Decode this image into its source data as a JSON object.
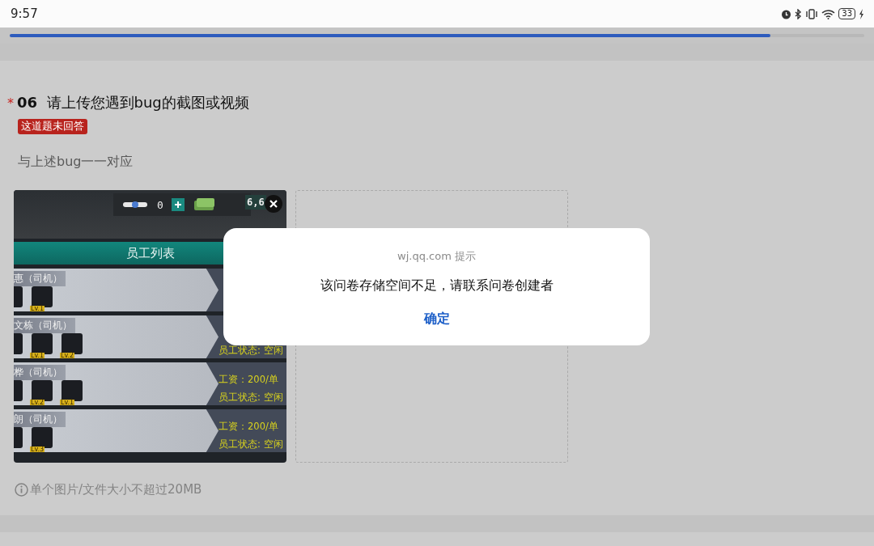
{
  "status_bar": {
    "time": "9:57",
    "battery": "33"
  },
  "progress": {
    "level": 0.89
  },
  "question": {
    "required_mark": "*",
    "number": "06",
    "title": "请上传您遇到bug的截图或视频",
    "error_badge": "这道题未回答",
    "description": "与上述bug一一对应"
  },
  "uploads": [
    {
      "kind": "screenshot",
      "currency": "0",
      "money": "6,6",
      "header": "员工列表",
      "rows": [
        {
          "name": "惠（司机）",
          "skills": [
            "Lv.1"
          ]
        },
        {
          "name": "文栋（司机）",
          "skills": [
            "Lv.1",
            "Lv.2"
          ],
          "status": "员工状态: 空闲"
        },
        {
          "name": "桦（司机）",
          "skills": [
            "Lv.2",
            "Lv.1"
          ],
          "salary": "工资：200/单",
          "status": "员工状态: 空闲"
        },
        {
          "name": "朗（司机）",
          "skills": [
            "Lv.3"
          ],
          "salary": "工资：200/单",
          "status": "员工状态: 空闲"
        }
      ]
    },
    {
      "kind": "empty"
    }
  ],
  "hint": "单个图片/文件大小不超过20MB",
  "dialog": {
    "source": "wj.qq.com 提示",
    "message": "该问卷存储空间不足，请联系问卷创建者",
    "button": "确定"
  }
}
